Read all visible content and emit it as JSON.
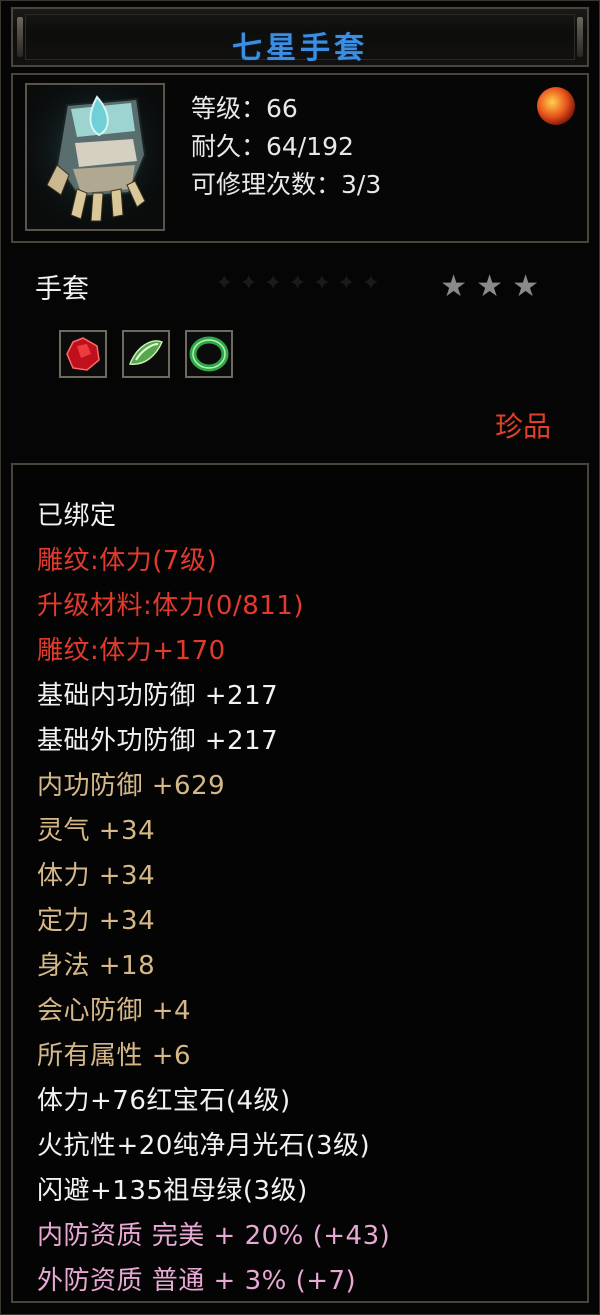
{
  "colors": {
    "title": "#3b8ee0",
    "white": "#f2f2f2",
    "red": "#e23a2c",
    "gold": "#d6b888",
    "pink": "#e8a9d4"
  },
  "item": {
    "name": "七星手套",
    "level_line": "等级：66",
    "durability_line": "耐久：64/192",
    "repair_line": "可修理次数：3/3",
    "type": "手套",
    "stars": [
      "★",
      "★",
      "★"
    ],
    "rarity": "珍品",
    "gems": [
      {
        "icon": "ruby-gem-icon"
      },
      {
        "icon": "moonstone-gem-icon"
      },
      {
        "icon": "emerald-ring-icon"
      }
    ]
  },
  "attributes": [
    {
      "text": "已绑定",
      "color": "white"
    },
    {
      "text": "雕纹:体力(7级)",
      "color": "red"
    },
    {
      "text": "升级材料:体力(0/811)",
      "color": "red"
    },
    {
      "text": "雕纹:体力+170",
      "color": "red"
    },
    {
      "text": "基础内功防御 +217",
      "color": "white"
    },
    {
      "text": "基础外功防御 +217",
      "color": "white"
    },
    {
      "text": "内功防御 +629",
      "color": "gold"
    },
    {
      "text": "灵气 +34",
      "color": "gold"
    },
    {
      "text": "体力 +34",
      "color": "gold"
    },
    {
      "text": "定力 +34",
      "color": "gold"
    },
    {
      "text": "身法 +18",
      "color": "gold"
    },
    {
      "text": "会心防御 +4",
      "color": "gold"
    },
    {
      "text": "所有属性 +6",
      "color": "gold"
    },
    {
      "text": "体力+76红宝石(4级)",
      "color": "white"
    },
    {
      "text": "火抗性+20纯净月光石(3级)",
      "color": "white"
    },
    {
      "text": "闪避+135祖母绿(3级)",
      "color": "white"
    },
    {
      "text": "内防资质 完美 + 20% (+43)",
      "color": "pink"
    },
    {
      "text": "外防资质 普通 + 3% (+7)",
      "color": "pink"
    }
  ]
}
